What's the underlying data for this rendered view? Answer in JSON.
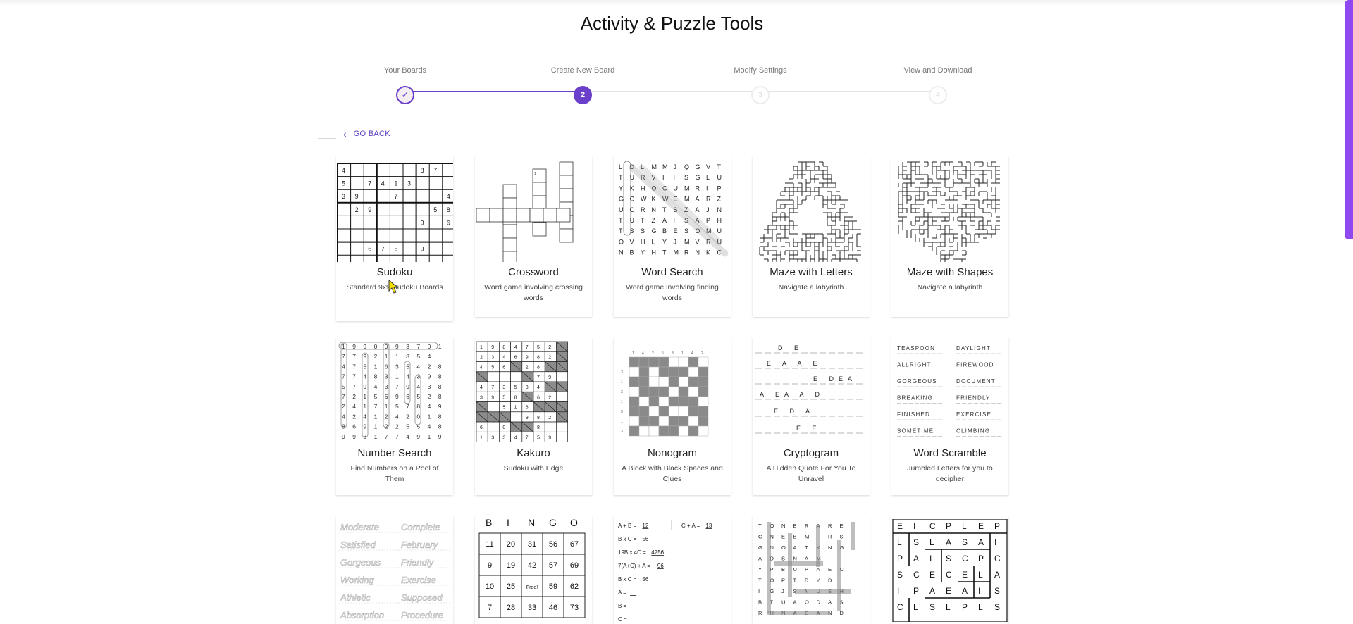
{
  "page_title": "Activity & Puzzle Tools",
  "stepper": [
    {
      "label": "Your Boards",
      "marker": "✓",
      "state": "done"
    },
    {
      "label": "Create New Board",
      "marker": "2",
      "state": "active"
    },
    {
      "label": "Modify Settings",
      "marker": "3",
      "state": "todo"
    },
    {
      "label": "View and Download",
      "marker": "4",
      "state": "todo"
    }
  ],
  "go_back": {
    "label": "GO BACK",
    "icon": "chevron-left-icon"
  },
  "colors": {
    "accent": "#6a3fc9",
    "kakuro_shade": "#8c8c8c",
    "nonogram_fill": "#8a8a8a"
  },
  "cards": [
    {
      "title": "Sudoku",
      "desc": "Standard 9x9 Sudoku Boards"
    },
    {
      "title": "Crossword",
      "desc": "Word game involving crossing words"
    },
    {
      "title": "Word Search",
      "desc": "Word game involving finding words"
    },
    {
      "title": "Maze with Letters",
      "desc": "Navigate a labyrinth"
    },
    {
      "title": "Maze with Shapes",
      "desc": "Navigate a labyrinth"
    },
    {
      "title": "Number Search",
      "desc": "Find Numbers on a Pool of Them"
    },
    {
      "title": "Kakuro",
      "desc": "Sudoku with Edge"
    },
    {
      "title": "Nonogram",
      "desc": "A Block with Black Spaces and Clues"
    },
    {
      "title": "Cryptogram",
      "desc": "A Hidden Quote For You To Unravel"
    },
    {
      "title": "Word Scramble",
      "desc": "Jumbled Letters for you to decipher"
    },
    {
      "title": "",
      "desc": ""
    },
    {
      "title": "",
      "desc": ""
    },
    {
      "title": "",
      "desc": ""
    },
    {
      "title": "",
      "desc": ""
    },
    {
      "title": "",
      "desc": ""
    }
  ],
  "thumbs": {
    "sudoku_rows": [
      [
        "4",
        "",
        "",
        "",
        "",
        "",
        "8",
        "7",
        ""
      ],
      [
        "5",
        "",
        "7",
        "4",
        "1",
        "3",
        "",
        "",
        ""
      ],
      [
        "3",
        "9",
        "",
        "",
        "7",
        "",
        "",
        "",
        "4"
      ],
      [
        "",
        "2",
        "9",
        "",
        "",
        "",
        "",
        "5",
        "8"
      ],
      [
        "",
        "",
        "",
        "",
        "",
        "",
        "9",
        "",
        "6",
        "7"
      ],
      [
        "",
        "",
        "",
        "",
        "",
        "",
        "",
        "",
        ""
      ],
      [
        "",
        "",
        "6",
        "7",
        "5",
        "",
        "9",
        "",
        ""
      ],
      [
        "",
        "",
        "",
        "",
        "",
        "",
        "",
        "",
        ""
      ],
      [
        "9",
        "7",
        "3",
        "",
        "",
        "",
        "",
        "",
        ""
      ]
    ],
    "wordsearch_rows": [
      "LDLMMJQGVT",
      "TURVIISGLU",
      "YKHOCUMRIP",
      "GOWKWEMARZ",
      "UORNTSZAJN",
      "TUTZAISAPH",
      "TSSGBESOMU",
      "OVHLYJMVRU",
      "NBYHTMRNKC"
    ],
    "numbersearch_rows": [
      "1990093701 4",
      "7792118 5 4",
      "4751635428",
      "7748314398",
      "5794379438",
      "7215696528",
      "2417157849",
      "4241242018",
      "8691225548",
      "9931774919"
    ],
    "kakuro_rows": [
      "1984752",
      "2346982",
      "4565289",
      "    179",
      "4735849",
      "3958462",
      "8 5164",
      "    9825",
      "6 0 28",
      "1334759"
    ],
    "cryptogram_lines": [
      "D E",
      "E A A E",
      "E DEA",
      "A EA A D",
      "E D A",
      "E E"
    ],
    "scramble_words": [
      [
        "TEASPOON",
        "DAYLIGHT"
      ],
      [
        "ALLRIGHT",
        "FIREWOOD"
      ],
      [
        "GORGEOUS",
        "DOCUMENT"
      ],
      [
        "BREAKING",
        "FRIENDLY"
      ],
      [
        "FINISHED",
        "EXERCISE"
      ],
      [
        "SOMETIME",
        "CLIMBING"
      ]
    ],
    "tracing_words": [
      [
        "Moderate",
        "Complete"
      ],
      [
        "Satisfied",
        "February"
      ],
      [
        "Gorgeous",
        "Friendly"
      ],
      [
        "Working",
        "Exercise"
      ],
      [
        "Athletic",
        "Supposed"
      ],
      [
        "Absorption",
        "Procedure"
      ]
    ],
    "bingo_header": [
      "B",
      "I",
      "N",
      "G",
      "O"
    ],
    "bingo_rows": [
      [
        "11",
        "20",
        "31",
        "56",
        "67"
      ],
      [
        "9",
        "19",
        "42",
        "57",
        "69"
      ],
      [
        "10",
        "25",
        "Free!",
        "59",
        "62"
      ],
      [
        "7",
        "28",
        "33",
        "46",
        "73"
      ]
    ],
    "algebra_lines": [
      [
        "A + B = ",
        "12",
        "C + A = ",
        "13"
      ],
      [
        "B x C = ",
        "56"
      ],
      [
        "19B x 4C = ",
        "4256"
      ],
      [
        "7(A+C) + A = ",
        "96"
      ],
      [
        "B x C = ",
        "56"
      ],
      [
        "A = ",
        ""
      ],
      [
        "B = ",
        ""
      ],
      [
        "C = ",
        ""
      ]
    ],
    "lettermaze_rows": [
      "TONBRARE",
      "GNEBMIRS",
      "GNOATKNG",
      "ADSNAM",
      "YPBUPAEC",
      "TOPTDYD",
      "IGJSNUSH",
      "BTUAODAS",
      "RHNAEAND"
    ],
    "lettergrid_rows": [
      "EICPLEP",
      "LSLASAI",
      "PAISCPC",
      "SCECELA",
      "IPAEAIS",
      "CLSLPLS"
    ]
  }
}
